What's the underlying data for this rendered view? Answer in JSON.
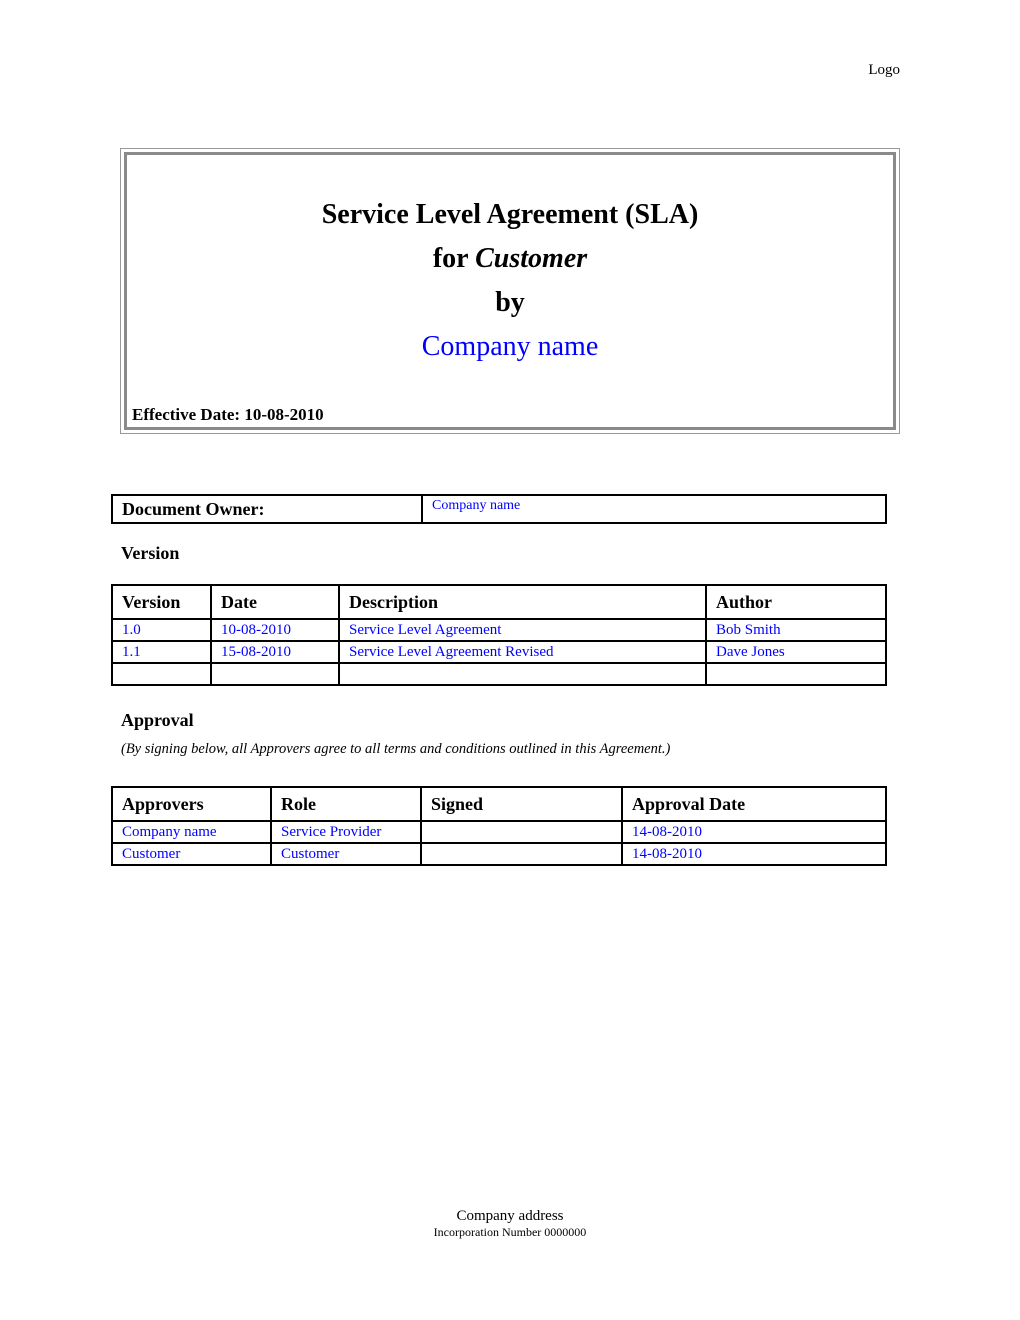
{
  "header": {
    "logo_text": "Logo"
  },
  "title_box": {
    "line1": "Service Level Agreement (SLA)",
    "line2_prefix": "for ",
    "line2_italic": "Customer",
    "line3": "by",
    "line4": "Company name",
    "effective_date": "Effective Date: 10-08-2010"
  },
  "owner": {
    "label": "Document Owner:",
    "value": "Company name"
  },
  "version_section": {
    "heading": "Version",
    "columns": [
      "Version",
      "Date",
      "Description",
      "Author"
    ],
    "rows": [
      [
        "1.0",
        "10-08-2010",
        "Service Level Agreement",
        "Bob Smith"
      ],
      [
        "1.1",
        "15-08-2010",
        "Service Level Agreement Revised",
        "Dave Jones"
      ],
      [
        "",
        "",
        "",
        ""
      ]
    ]
  },
  "approval_section": {
    "heading": "Approval",
    "note": "(By signing below, all Approvers agree to all terms and conditions outlined in this Agreement.)",
    "columns": [
      "Approvers",
      "Role",
      "Signed",
      "Approval Date"
    ],
    "rows": [
      [
        "Company name",
        "Service Provider",
        "",
        "14-08-2010"
      ],
      [
        "Customer",
        "Customer",
        "",
        "14-08-2010"
      ]
    ]
  },
  "footer": {
    "address": "Company address",
    "incorporation": "Incorporation Number 0000000"
  },
  "colors": {
    "link_blue": "#0000ff",
    "border_gray": "#8a8a8a"
  }
}
